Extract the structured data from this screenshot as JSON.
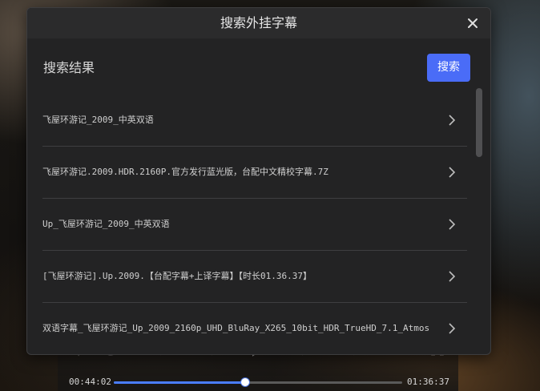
{
  "dialog": {
    "title": "搜索外挂字幕",
    "section_title": "搜索结果",
    "search_button_label": "搜索"
  },
  "results": [
    {
      "label": "飞屋环游记_2009_中英双语"
    },
    {
      "label": "飞屋环游记.2009.HDR.2160P.官方发行蓝光版，台配中文精校字幕.7Z"
    },
    {
      "label": "Up_飞屋环游记_2009_中英双语"
    },
    {
      "label": "[飞屋环游记].Up.2009.【台配字幕+上译字幕】【时长01.36.37】"
    },
    {
      "label": "双语字幕_飞屋环游记_Up_2009_2160p_UHD_BluRay_X265_10bit_HDR_TrueHD_7.1_Atmos"
    }
  ],
  "player": {
    "current_time": "00:44:02",
    "total_time": "01:36:37",
    "progress_fraction": 0.456
  },
  "colors": {
    "accent": "#4a6cf7",
    "progress": "#4a7dff",
    "dialog_bg": "#232324"
  },
  "icons": {
    "close": "close-icon",
    "row_arrow": "chevron-right-icon"
  }
}
